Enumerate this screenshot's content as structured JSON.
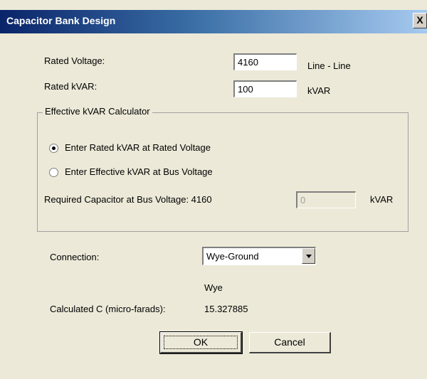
{
  "window": {
    "title": "Capacitor Bank Design",
    "close_label": "X"
  },
  "rated_voltage": {
    "label": "Rated Voltage:",
    "value": "4160",
    "unit": "Line - Line"
  },
  "rated_kvar": {
    "label": "Rated kVAR:",
    "value": "100",
    "unit": "kVAR"
  },
  "calculator": {
    "title": "Effective kVAR Calculator",
    "options": [
      {
        "label": "Enter Rated kVAR at Rated Voltage",
        "selected": true
      },
      {
        "label": "Enter Effective kVAR at Bus Voltage",
        "selected": false
      }
    ],
    "required_label": "Required Capacitor at Bus Voltage: 4160",
    "required_value": "0",
    "required_unit": "kVAR"
  },
  "connection": {
    "label": "Connection:",
    "selected": "Wye-Ground",
    "type_text": "Wye"
  },
  "calculated_c": {
    "label": "Calculated C (micro-farads):",
    "value": "15.327885"
  },
  "buttons": {
    "ok": "OK",
    "cancel": "Cancel"
  }
}
